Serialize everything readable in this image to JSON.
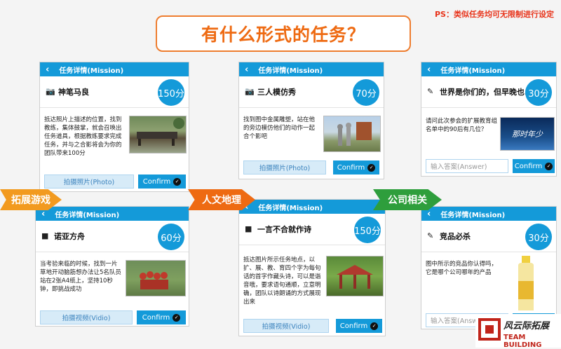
{
  "page": {
    "title": "有什么形式的任务？",
    "ps": "PS：类似任务均可无限制进行设定"
  },
  "common": {
    "header": "任务详情(Mission)",
    "back": "‹",
    "confirm": "Confirm",
    "answer_placeholder": "输入答案(Answer)"
  },
  "cards": [
    {
      "name": "神笔马良",
      "points": "150分",
      "desc": "抵达照片上描述的位置，找到教练，集体鼓掌，就会召唤出任务道具，根据教练要求完成任务，并与之合影将会为你的团队带来100分",
      "action": "拍摄照片(Photo)"
    },
    {
      "name": "三人模仿秀",
      "points": "70分",
      "desc": "找到图中金属雕塑，站在他的旁边模仿他们的动作一起合个影吧",
      "action": "拍摄照片(Photo)"
    },
    {
      "name": "世界是你们的，但早晚也...",
      "points": "30分",
      "desc": "请问此次参会的扩展教育组名单中的90后有几位？"
    },
    {
      "name": "诺亚方舟",
      "points": "60分",
      "desc": "当考验来临的时候，找到一片草地开动脑筋想办法让5名队员站在2张A4纸上，坚持10秒钟，即挑战成功",
      "action": "拍摄视频(Vidio)"
    },
    {
      "name": "一言不合就作诗",
      "points": "150分",
      "desc": "抵达图片所示任务地点，以扩、展、教、育四个字为每句话的首字作藏头诗，可以是谐音哦，要求语句通顺，立意明确，团队以诗朗诵的方式展现出来",
      "action": "拍摄视频(Vidio)"
    },
    {
      "name": "竞品必杀",
      "points": "30分",
      "desc": "图中所示的竞品你认得吗，它是哪个公司哪年的产品"
    }
  ],
  "ribbons": {
    "r1": "拓展游戏",
    "r2": "人文地理",
    "r3": "公司相关"
  },
  "photo_texts": {
    "slogan": "那时年少"
  },
  "logo": {
    "cn": "风云际拓展",
    "en": "TEAM BUILDING"
  },
  "colors": {
    "accent": "#149ad9",
    "orange": "#ee7d2f",
    "green": "#2e9e3c"
  },
  "icons": {
    "photo": "camera-icon",
    "video": "video-camera-icon",
    "text": "pencil-icon",
    "back": "chevron-left-icon",
    "check": "check-circle-icon"
  }
}
